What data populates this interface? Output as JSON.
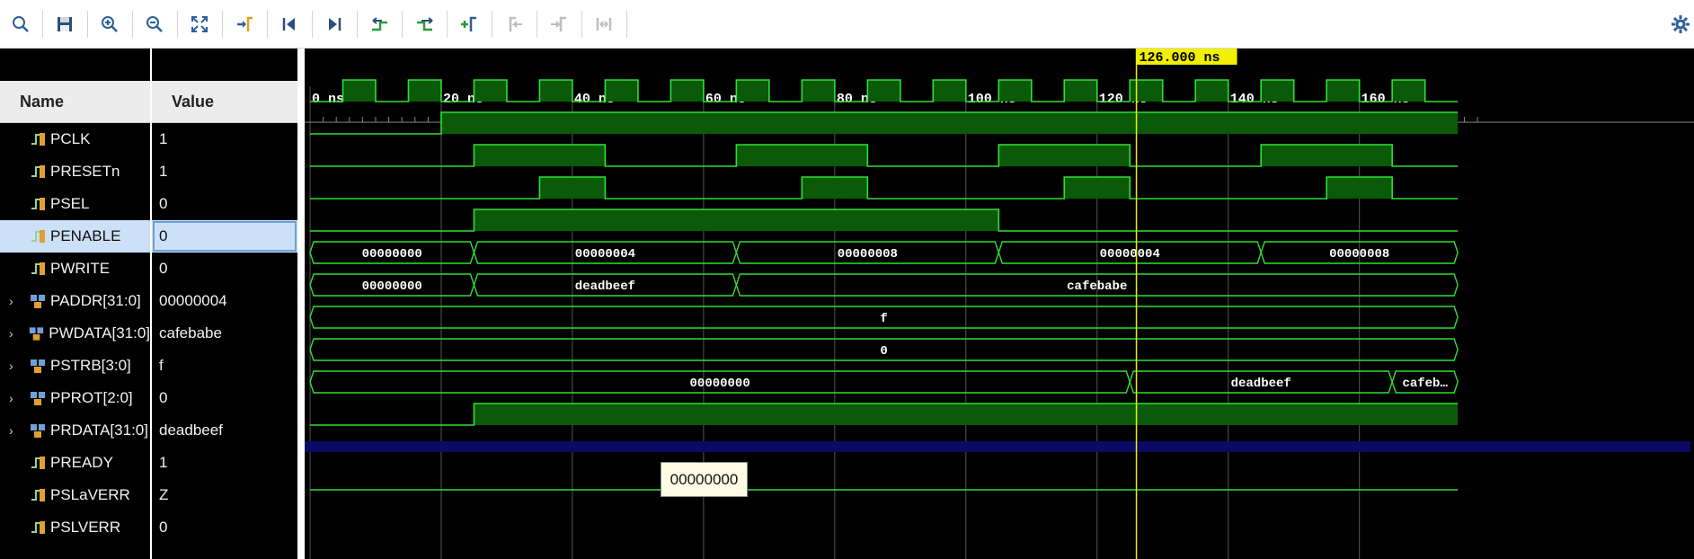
{
  "toolbar": {
    "buttons": [
      {
        "name": "search-button",
        "icon": "search-icon"
      },
      {
        "name": "save-button",
        "icon": "save-icon"
      },
      {
        "name": "zoom-in-button",
        "icon": "zoom-in-icon"
      },
      {
        "name": "zoom-out-button",
        "icon": "zoom-out-icon"
      },
      {
        "name": "zoom-fit-button",
        "icon": "zoom-fit-icon"
      },
      {
        "name": "go-to-cursor-button",
        "icon": "go-to-cursor-icon"
      },
      {
        "name": "go-to-start-button",
        "icon": "go-to-start-icon"
      },
      {
        "name": "go-to-end-button",
        "icon": "go-to-end-icon"
      },
      {
        "name": "previous-transition-button",
        "icon": "previous-transition-icon"
      },
      {
        "name": "next-transition-button",
        "icon": "next-transition-icon"
      },
      {
        "name": "add-marker-button",
        "icon": "add-marker-icon"
      },
      {
        "name": "previous-marker-button",
        "icon": "previous-marker-icon"
      },
      {
        "name": "next-marker-button",
        "icon": "next-marker-icon"
      },
      {
        "name": "swap-cursors-button",
        "icon": "swap-cursors-icon"
      },
      {
        "name": "settings-button",
        "icon": "gear-icon"
      }
    ]
  },
  "columns": {
    "name": "Name",
    "value": "Value"
  },
  "signals": [
    {
      "name": "PCLK",
      "value": "1",
      "type": "bit",
      "expandable": false,
      "selected": false
    },
    {
      "name": "PRESETn",
      "value": "1",
      "type": "bit",
      "expandable": false,
      "selected": false
    },
    {
      "name": "PSEL",
      "value": "0",
      "type": "bit",
      "expandable": false,
      "selected": false
    },
    {
      "name": "PENABLE",
      "value": "0",
      "type": "bit",
      "expandable": false,
      "selected": true
    },
    {
      "name": "PWRITE",
      "value": "0",
      "type": "bit",
      "expandable": false,
      "selected": false
    },
    {
      "name": "PADDR[31:0]",
      "value": "00000004",
      "type": "bus",
      "expandable": true,
      "selected": false
    },
    {
      "name": "PWDATA[31:0]",
      "value": "cafebabe",
      "type": "bus",
      "expandable": true,
      "selected": false
    },
    {
      "name": "PSTRB[3:0]",
      "value": "f",
      "type": "bus",
      "expandable": true,
      "selected": false
    },
    {
      "name": "PPROT[2:0]",
      "value": "0",
      "type": "bus",
      "expandable": true,
      "selected": false
    },
    {
      "name": "PRDATA[31:0]",
      "value": "deadbeef",
      "type": "bus",
      "expandable": true,
      "selected": false
    },
    {
      "name": "PREADY",
      "value": "1",
      "type": "bit",
      "expandable": false,
      "selected": false
    },
    {
      "name": "PSLaVERR",
      "value": "Z",
      "type": "bit",
      "expandable": false,
      "selected": false
    },
    {
      "name": "PSLVERR",
      "value": "0",
      "type": "bit",
      "expandable": false,
      "selected": false
    }
  ],
  "timeline": {
    "unit": "ns",
    "start": 0,
    "end": 175,
    "ticks": [
      0,
      20,
      40,
      60,
      80,
      100,
      120,
      140,
      160
    ],
    "tick_labels": [
      "0 ns",
      "20 ns",
      "40 ns",
      "60 ns",
      "80 ns",
      "100 ns",
      "120 ns",
      "140 ns",
      "160 ns"
    ],
    "cursor_time": 126,
    "cursor_label": "126.000 ns"
  },
  "waveforms": {
    "PCLK": {
      "kind": "clock",
      "period": 10,
      "first_rise": 5
    },
    "PRESETn": {
      "kind": "bit",
      "changes": [
        [
          0,
          0
        ],
        [
          20,
          1
        ]
      ]
    },
    "PSEL": {
      "kind": "bit",
      "changes": [
        [
          0,
          0
        ],
        [
          25,
          1
        ],
        [
          45,
          0
        ],
        [
          65,
          1
        ],
        [
          85,
          0
        ],
        [
          105,
          1
        ],
        [
          125,
          0
        ],
        [
          145,
          1
        ],
        [
          165,
          0
        ]
      ]
    },
    "PENABLE": {
      "kind": "bit",
      "changes": [
        [
          0,
          0
        ],
        [
          35,
          1
        ],
        [
          45,
          0
        ],
        [
          75,
          1
        ],
        [
          85,
          0
        ],
        [
          115,
          1
        ],
        [
          125,
          0
        ],
        [
          155,
          1
        ],
        [
          165,
          0
        ]
      ]
    },
    "PWRITE": {
      "kind": "bit",
      "changes": [
        [
          0,
          0
        ],
        [
          25,
          1
        ],
        [
          105,
          0
        ]
      ]
    },
    "PADDR": {
      "kind": "bus",
      "segments": [
        [
          0,
          25,
          "00000000"
        ],
        [
          25,
          65,
          "00000004"
        ],
        [
          65,
          105,
          "00000008"
        ],
        [
          105,
          145,
          "00000004"
        ],
        [
          145,
          175,
          "00000008"
        ]
      ]
    },
    "PWDATA": {
      "kind": "bus",
      "segments": [
        [
          0,
          25,
          "00000000"
        ],
        [
          25,
          65,
          "deadbeef"
        ],
        [
          65,
          175,
          "cafebabe"
        ]
      ]
    },
    "PSTRB": {
      "kind": "bus",
      "segments": [
        [
          0,
          175,
          "f"
        ]
      ]
    },
    "PPROT": {
      "kind": "bus",
      "segments": [
        [
          0,
          175,
          "0"
        ]
      ]
    },
    "PRDATA": {
      "kind": "bus",
      "segments": [
        [
          0,
          125,
          "00000000"
        ],
        [
          125,
          165,
          "deadbeef"
        ],
        [
          165,
          175,
          "cafeb…"
        ]
      ]
    },
    "PREADY": {
      "kind": "bit",
      "changes": [
        [
          0,
          0
        ],
        [
          25,
          1
        ]
      ]
    },
    "PSLaVERR": {
      "kind": "z"
    },
    "PSLVERR": {
      "kind": "bit",
      "changes": [
        [
          0,
          0
        ]
      ]
    }
  },
  "tooltip": {
    "text": "00000000"
  },
  "colors": {
    "wave_line": "#33dd33",
    "wave_fill": "#0a5a0a",
    "bus_text": "#ffffff",
    "grid": "#555555",
    "cursor": "#f0f000",
    "cursor_label_bg": "#f0f000",
    "z_fill": "#0a0a66",
    "background": "#000000"
  }
}
